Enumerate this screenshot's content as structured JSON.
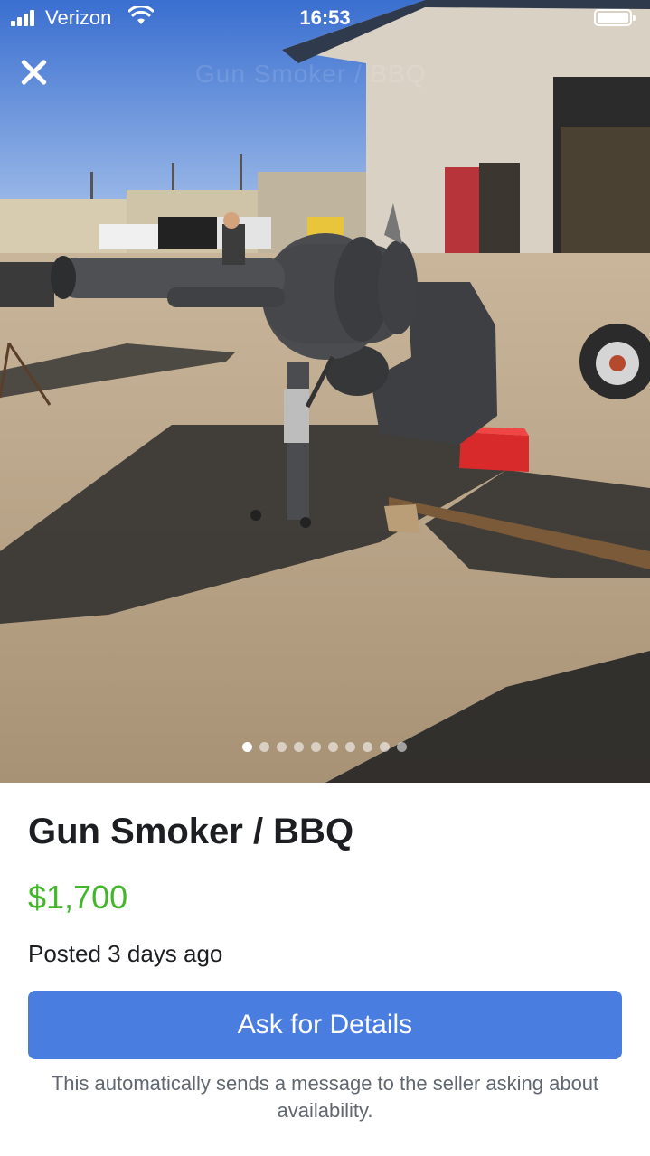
{
  "status_bar": {
    "carrier": "Verizon",
    "time": "16:53",
    "signal_icon": "signal-bars-icon",
    "wifi_icon": "wifi-icon",
    "battery_icon": "battery-icon"
  },
  "photo": {
    "watermark": "Gun Smoker / BBQ",
    "close_icon": "close-icon",
    "carousel": {
      "total": 10,
      "active_index": 0
    }
  },
  "listing": {
    "title": "Gun Smoker / BBQ",
    "price": "$1,700",
    "posted": "Posted 3 days ago",
    "ask_button": "Ask for Details",
    "ask_note": "This automatically sends a message to the seller asking about availability."
  },
  "colors": {
    "price": "#42b72a",
    "button": "#4a7de0",
    "title": "#1c1e21",
    "note": "#606770"
  }
}
